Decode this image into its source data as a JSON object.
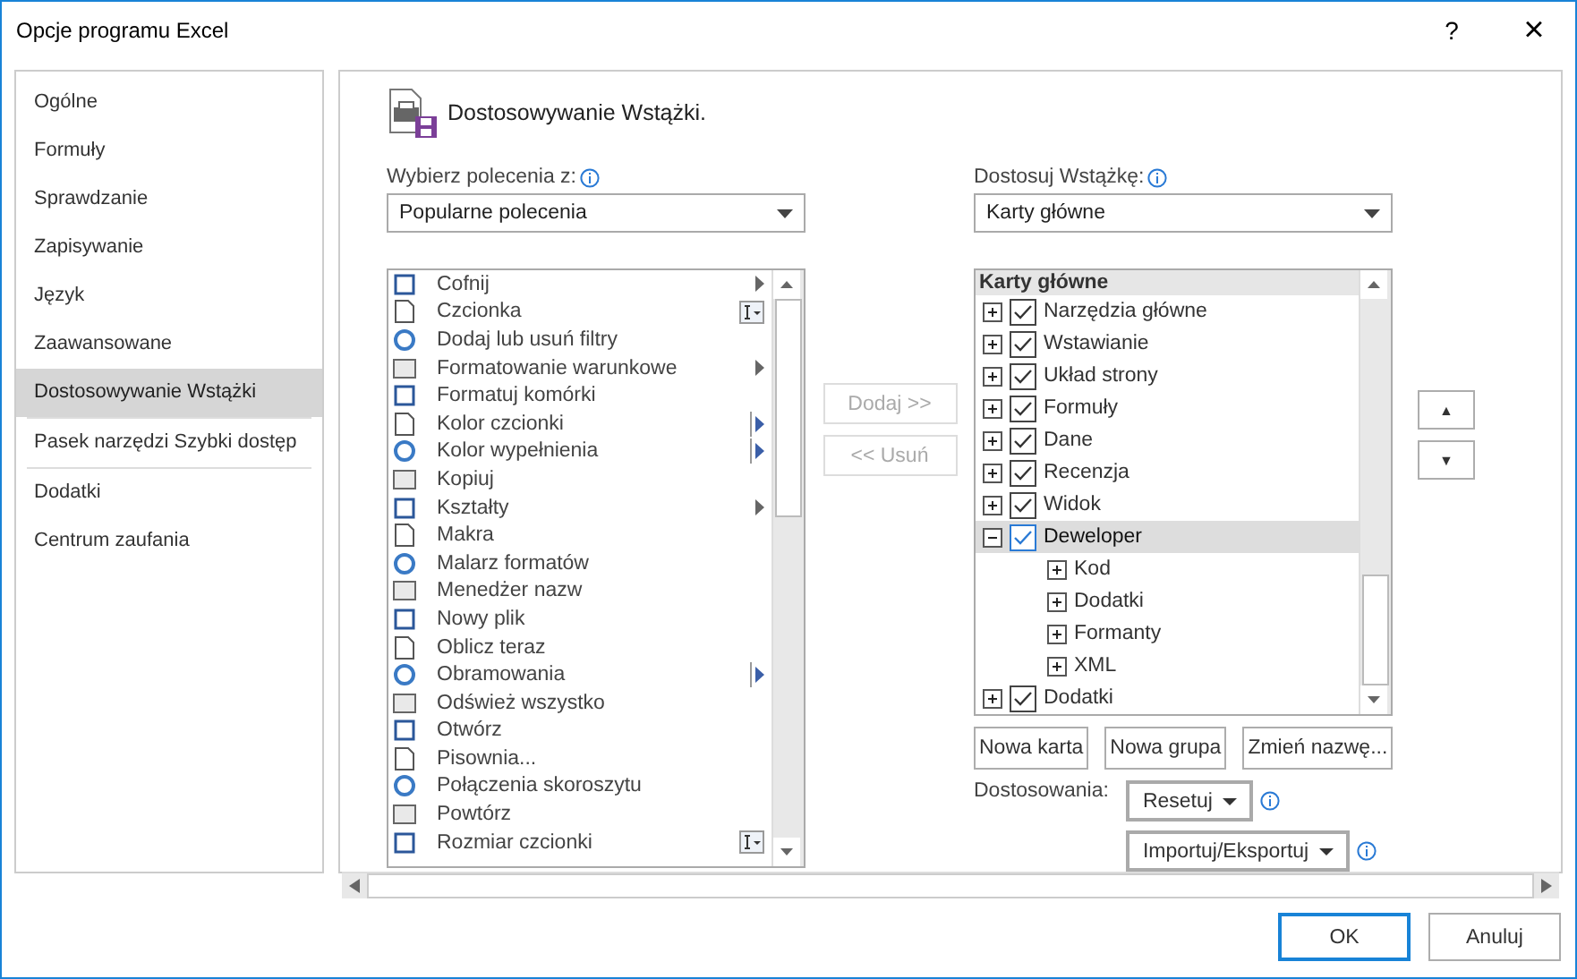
{
  "window": {
    "title": "Opcje programu Excel",
    "help": "?",
    "close": "×"
  },
  "sidebar": {
    "items": [
      {
        "label": "Ogólne",
        "selected": false
      },
      {
        "label": "Formuły",
        "selected": false
      },
      {
        "label": "Sprawdzanie",
        "selected": false
      },
      {
        "label": "Zapisywanie",
        "selected": false
      },
      {
        "label": "Język",
        "selected": false
      },
      {
        "label": "Zaawansowane",
        "selected": false
      },
      {
        "label": "Dostosowywanie Wstążki",
        "selected": true
      },
      {
        "label": "Pasek narzędzi Szybki dostęp",
        "selected": false
      },
      {
        "label": "Dodatki",
        "selected": false
      },
      {
        "label": "Centrum zaufania",
        "selected": false
      }
    ]
  },
  "heading": "Dostosowywanie Wstążki.",
  "commands_label": "Wybierz polecenia z:",
  "commands_source": "Popularne polecenia",
  "commands": [
    {
      "label": "Cofnij",
      "kind": "submenu"
    },
    {
      "label": "Czcionka",
      "kind": "font-box"
    },
    {
      "label": "Dodaj lub usuń filtry",
      "kind": "plain"
    },
    {
      "label": "Formatowanie warunkowe",
      "kind": "submenu"
    },
    {
      "label": "Formatuj komórki",
      "kind": "plain"
    },
    {
      "label": "Kolor czcionki",
      "kind": "split"
    },
    {
      "label": "Kolor wypełnienia",
      "kind": "split"
    },
    {
      "label": "Kopiuj",
      "kind": "plain"
    },
    {
      "label": "Kształty",
      "kind": "submenu"
    },
    {
      "label": "Makra",
      "kind": "plain"
    },
    {
      "label": "Malarz formatów",
      "kind": "plain"
    },
    {
      "label": "Menedżer nazw",
      "kind": "plain"
    },
    {
      "label": "Nowy plik",
      "kind": "plain"
    },
    {
      "label": "Oblicz teraz",
      "kind": "plain"
    },
    {
      "label": "Obramowania",
      "kind": "split"
    },
    {
      "label": "Odśwież wszystko",
      "kind": "plain"
    },
    {
      "label": "Otwórz",
      "kind": "plain"
    },
    {
      "label": "Pisownia...",
      "kind": "plain"
    },
    {
      "label": "Połączenia skoroszytu",
      "kind": "plain"
    },
    {
      "label": "Powtórz",
      "kind": "plain"
    },
    {
      "label": "Rozmiar czcionki",
      "kind": "font-box"
    }
  ],
  "add_button": {
    "label": "Dodaj >>",
    "disabled": true
  },
  "remove_button": {
    "label": "<< Usuń",
    "disabled": true
  },
  "ribbon_label": "Dostosuj Wstążkę:",
  "ribbon_source": "Karty główne",
  "ribbon_header": "Karty główne",
  "ribbon_tabs": [
    {
      "label": "Narzędzia główne",
      "checked": true,
      "expanded": false,
      "selected": false
    },
    {
      "label": "Wstawianie",
      "checked": true,
      "expanded": false,
      "selected": false
    },
    {
      "label": "Układ strony",
      "checked": true,
      "expanded": false,
      "selected": false
    },
    {
      "label": "Formuły",
      "checked": true,
      "expanded": false,
      "selected": false
    },
    {
      "label": "Dane",
      "checked": true,
      "expanded": false,
      "selected": false
    },
    {
      "label": "Recenzja",
      "checked": true,
      "expanded": false,
      "selected": false
    },
    {
      "label": "Widok",
      "checked": true,
      "expanded": false,
      "selected": false
    },
    {
      "label": "Deweloper",
      "checked": true,
      "expanded": true,
      "selected": true,
      "children": [
        {
          "label": "Kod",
          "expanded": false
        },
        {
          "label": "Dodatki",
          "expanded": false
        },
        {
          "label": "Formanty",
          "expanded": false
        },
        {
          "label": "XML",
          "expanded": false
        }
      ]
    },
    {
      "label": "Dodatki",
      "checked": true,
      "expanded": false,
      "selected": false
    }
  ],
  "move_up": "▲",
  "move_down": "▼",
  "tree_buttons": [
    "Nowa karta",
    "Nowa grupa",
    "Zmień nazwę..."
  ],
  "customizations_label": "Dostosowania:",
  "reset_button": "Resetuj",
  "import_export_button": "Importuj/Eksportuj",
  "footer_buttons": [
    "OK",
    "Anuluj"
  ]
}
